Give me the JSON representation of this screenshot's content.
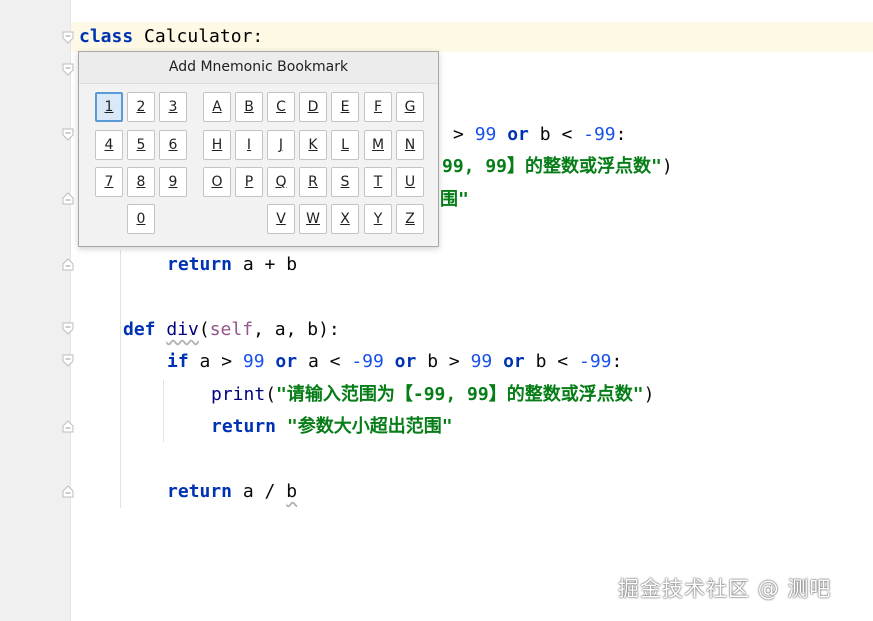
{
  "editor": {
    "lines": {
      "class_kw": "class",
      "class_name": "Calculator",
      "class_colon": ":",
      "l3_cond_tail_gt": ">",
      "l3_num99": "99",
      "l3_or": "or",
      "l3_b": "b",
      "l3_lt": "<",
      "l3_neg99": "-99",
      "l3_colon": ":",
      "l4_str_tail": "99, 99】的整数或浮点数\"",
      "l4_paren": ")",
      "l5_str_tail": "围\"",
      "ret1_kw": "return",
      "ret1_expr": "a + b",
      "def_kw": "def",
      "def_name": "div",
      "def_self": "self",
      "def_params": ", a, b):",
      "if_kw": "if",
      "if_a": "a >",
      "if_99a": "99",
      "if_or1": "or",
      "if_a2": "a <",
      "if_neg99a": "-99",
      "if_or2": "or",
      "if_b": "b >",
      "if_99b": "99",
      "if_or3": "or",
      "if_b2": "b <",
      "if_neg99b": "-99",
      "if_colon": ":",
      "print_fn": "print",
      "print_open": "(",
      "print_str": "\"请输入范围为【-99, 99】的整数或浮点数\"",
      "print_close": ")",
      "ret2_kw": "return",
      "ret2_str": "\"参数大小超出范围\"",
      "ret3_kw": "return",
      "ret3_a": "a /",
      "ret3_b": "b"
    }
  },
  "popup": {
    "title": "Add Mnemonic Bookmark",
    "rows": [
      [
        "1",
        "2",
        "3",
        "A",
        "B",
        "C",
        "D",
        "E",
        "F",
        "G"
      ],
      [
        "4",
        "5",
        "6",
        "H",
        "I",
        "J",
        "K",
        "L",
        "M",
        "N"
      ],
      [
        "7",
        "8",
        "9",
        "O",
        "P",
        "Q",
        "R",
        "S",
        "T",
        "U"
      ],
      [
        "0",
        "V",
        "W",
        "X",
        "Y",
        "Z"
      ]
    ],
    "selected": "1"
  },
  "watermark": "掘金技术社区 @ 测吧"
}
